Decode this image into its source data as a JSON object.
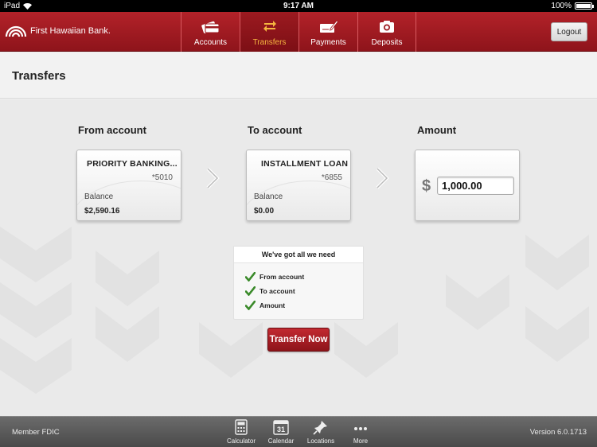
{
  "status_bar": {
    "device": "iPad",
    "time": "9:17 AM",
    "battery": "100%"
  },
  "header": {
    "bank_name": "First Hawaiian Bank.",
    "nav": [
      {
        "label": "Accounts",
        "icon": "credit-card-icon",
        "active": false
      },
      {
        "label": "Transfers",
        "icon": "transfer-arrows-icon",
        "active": true
      },
      {
        "label": "Payments",
        "icon": "check-pen-icon",
        "active": false
      },
      {
        "label": "Deposits",
        "icon": "camera-icon",
        "active": false
      }
    ],
    "logout_label": "Logout",
    "colors": {
      "brand_red": "#a01c23",
      "active_tab_text": "#f5b640"
    }
  },
  "page_title": "Transfers",
  "from_account": {
    "label": "From account",
    "name": "PRIORITY BANKING...",
    "number": "*5010",
    "balance_label": "Balance",
    "balance": "$2,590.16"
  },
  "to_account": {
    "label": "To account",
    "name": "INSTALLMENT LOAN",
    "number": "*6855",
    "balance_label": "Balance",
    "balance": "$0.00"
  },
  "amount": {
    "label": "Amount",
    "currency": "$",
    "value": "1,000.00"
  },
  "checklist": {
    "title": "We've got all we need",
    "items": [
      "From account",
      "To account",
      "Amount"
    ],
    "check_color": "#3a8a2a"
  },
  "transfer_button": "Transfer Now",
  "footer": {
    "member": "Member FDIC",
    "version": "Version 6.0.1713",
    "tools": [
      {
        "label": "Calculator",
        "icon": "calculator-icon"
      },
      {
        "label": "Calendar",
        "icon": "calendar-icon",
        "day": "31"
      },
      {
        "label": "Locations",
        "icon": "pin-icon"
      },
      {
        "label": "More",
        "icon": "more-dots-icon"
      }
    ]
  }
}
